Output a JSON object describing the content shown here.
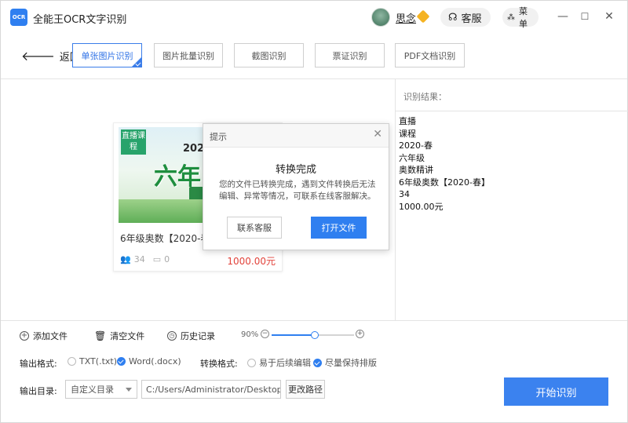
{
  "titlebar": {
    "logo_text": "OCR",
    "title": "全能王OCR文字识别",
    "username": "思念",
    "service_label": "客服",
    "menu_label": "菜单",
    "minimize": "—",
    "maximize": "☐",
    "close": "✕"
  },
  "toolbar": {
    "back_label": "返回",
    "tabs": [
      {
        "label": "单张图片识别"
      },
      {
        "label": "图片批量识别"
      },
      {
        "label": "截图识别"
      },
      {
        "label": "票证识别"
      },
      {
        "label": "PDF文档识别"
      }
    ]
  },
  "card": {
    "badge": "直播课程",
    "year": "2020",
    "big_text": "六年",
    "sub_text": "奥数精",
    "title": "6年级奥数【2020-春",
    "likes": "34",
    "comments": "0",
    "price": "1000.00元"
  },
  "dialog": {
    "title": "提示",
    "close": "✕",
    "heading": "转换完成",
    "message": "您的文件已转换完成，遇到文件转换后无法编辑、异常等情况，可联系在线客服解决。",
    "contact_label": "联系客服",
    "open_label": "打开文件"
  },
  "results": {
    "label": "识别结果：",
    "lines": [
      "直播",
      "课程",
      "2020-春",
      "六年级",
      "奥数精讲",
      "6年级奥数【2020-春】",
      "34",
      "1000.00元"
    ]
  },
  "bottom": {
    "add_file": "添加文件",
    "clear_file": "清空文件",
    "history": "历史记录",
    "zoom": "90%",
    "zoom_level": 0.52,
    "output_format_label": "输出格式:",
    "format_txt": "TXT(.txt)",
    "format_word": "Word(.docx)",
    "convert_format_label": "转换格式:",
    "convert_editable": "易于后续编辑",
    "convert_layout": "尽量保持排版",
    "output_dir_label": "输出目录:",
    "dir_select": "自定义目录",
    "dir_path": "C:/Users/Administrator/Desktop/OC",
    "change_path": "更改路径",
    "start": "开始识别"
  }
}
